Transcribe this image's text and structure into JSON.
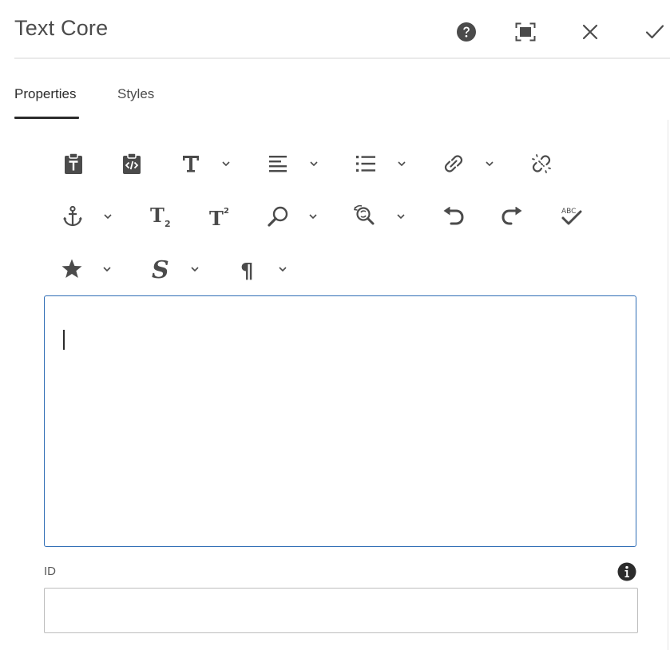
{
  "dialog": {
    "title": "Text Core"
  },
  "header_actions": [
    {
      "name": "help-icon",
      "label": "Help"
    },
    {
      "name": "fullscreen-icon",
      "label": "Toggle fullscreen"
    },
    {
      "name": "close-icon",
      "label": "Cancel"
    },
    {
      "name": "checkmark-icon",
      "label": "Done"
    }
  ],
  "tabs": [
    {
      "label": "Properties",
      "active": true
    },
    {
      "label": "Styles",
      "active": false
    }
  ],
  "toolbar": {
    "rows": [
      [
        "paste-as-text-icon",
        "paste-wordhtml-icon",
        "format-text-icon",
        "justify-icon",
        "list-icon",
        "link-icon",
        "unlink-icon"
      ],
      [
        "anchor-icon",
        "subscript-icon",
        "superscript-icon",
        "find-icon",
        "replace-icon",
        "undo-icon",
        "redo-icon",
        "spellcheck-icon"
      ],
      [
        "special-characters-icon",
        "styles-icon",
        "paragraph-format-icon"
      ]
    ],
    "subscript_glyph": "T",
    "subscript_index": "2",
    "superscript_glyph": "T",
    "superscript_index": "2",
    "spellcheck_text": "ABC",
    "styles_glyph": "S",
    "paragraph_glyph": "¶"
  },
  "editor": {
    "content": ""
  },
  "id_field": {
    "label": "ID",
    "value": "",
    "placeholder": ""
  },
  "colors": {
    "accent": "#2f6db5",
    "icon": "#4b4b4b",
    "text": "#2c2c2c"
  }
}
